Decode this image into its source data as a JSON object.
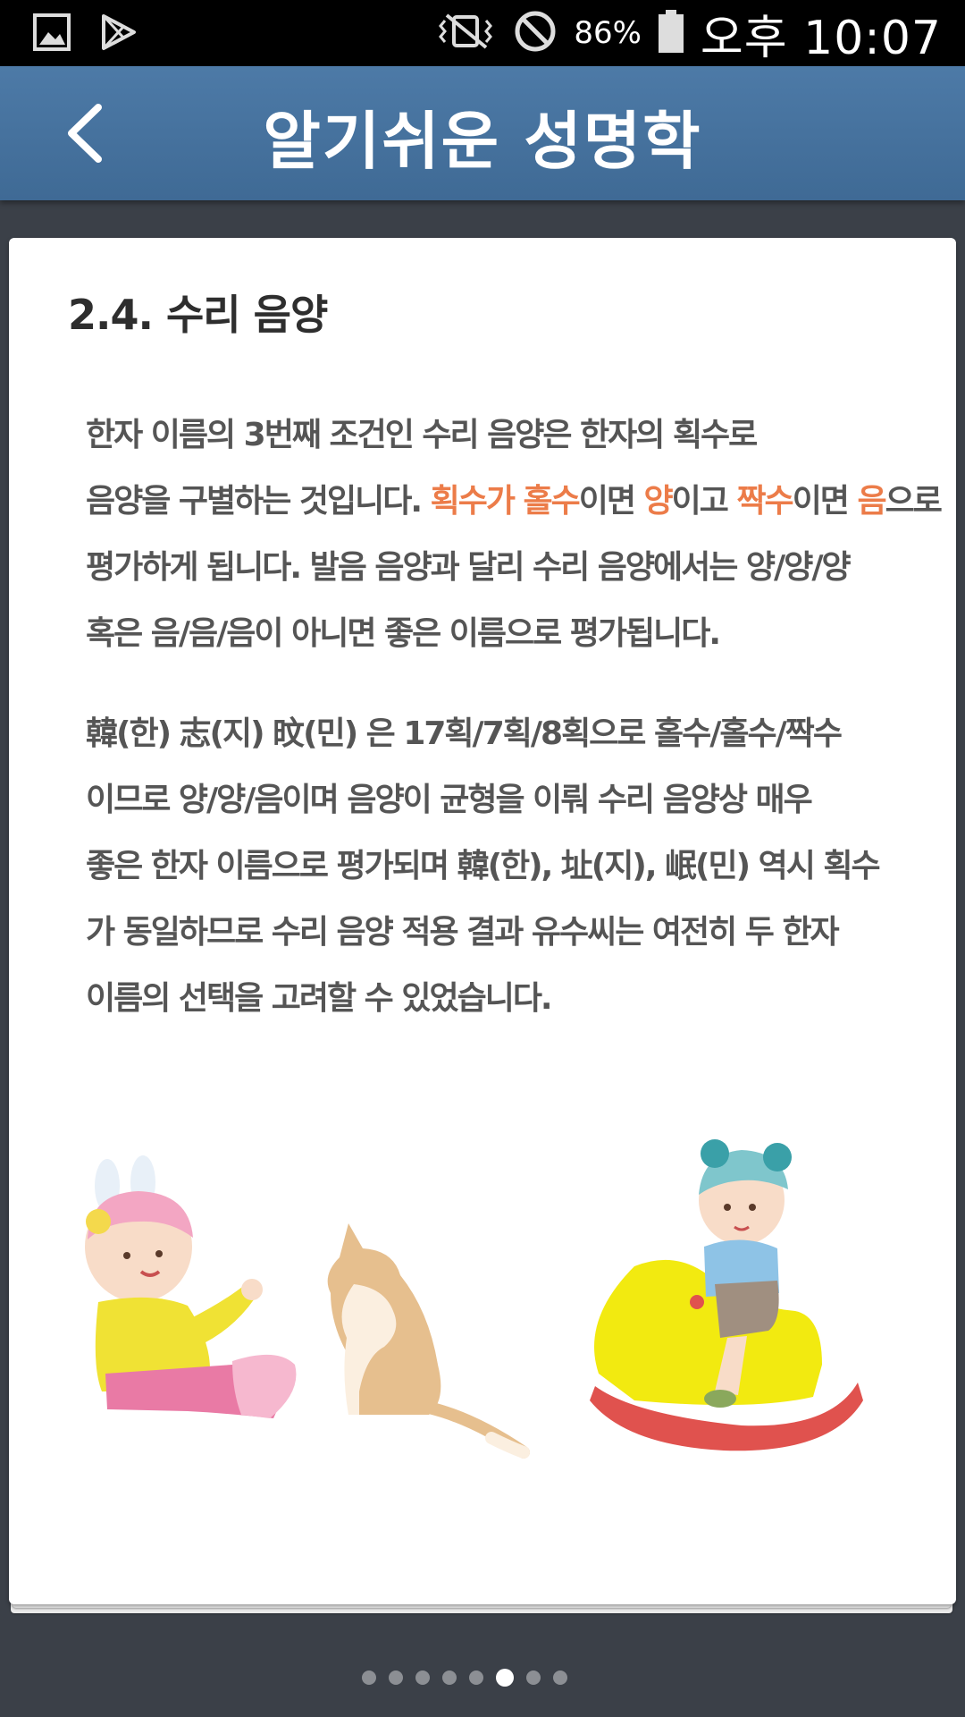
{
  "status_bar": {
    "battery": "86%",
    "time": "오후 10:07",
    "icons": [
      "gallery-icon",
      "play-store-icon",
      "vibrate-icon",
      "do-not-disturb-icon",
      "battery-icon"
    ]
  },
  "header": {
    "title": "알기쉬운 성명학",
    "back_icon": "chevron-left-icon"
  },
  "content": {
    "section_title": "2.4.  수리 음양",
    "p1": {
      "l1": "한자 이름의 3번째 조건인 수리 음양은 한자의 획수로",
      "l2_a": "음양을 구별하는 것입니다. ",
      "l2_b": "획수가 홀수",
      "l2_c": "이면 ",
      "l2_d": "양",
      "l2_e": "이고 ",
      "l2_f": "짝수",
      "l2_g": "이면 ",
      "l2_h": "음",
      "l2_i": "으로",
      "l3": "평가하게 됩니다. 발음 음양과 달리 수리 음양에서는 양/양/양",
      "l4": "혹은 음/음/음이 아니면 좋은 이름으로 평가됩니다."
    },
    "p2": {
      "l1": "韓(한)  志(지)  旼(민) 은 17획/7획/8획으로 홀수/홀수/짝수",
      "l2": "이므로 양/양/음이며 음양이 균형을 이뤄 수리 음양상 매우",
      "l3": "좋은 한자 이름으로 평가되며 韓(한), 址(지), 岷(민) 역시 획수",
      "l4": "가 동일하므로 수리 음양 적용 결과 유수씨는 여전히 두 한자",
      "l5": "이름의 선택을 고려할 수 있었습니다."
    },
    "highlight_color": "#ec7c49"
  },
  "pager": {
    "total": 8,
    "active": 5
  }
}
